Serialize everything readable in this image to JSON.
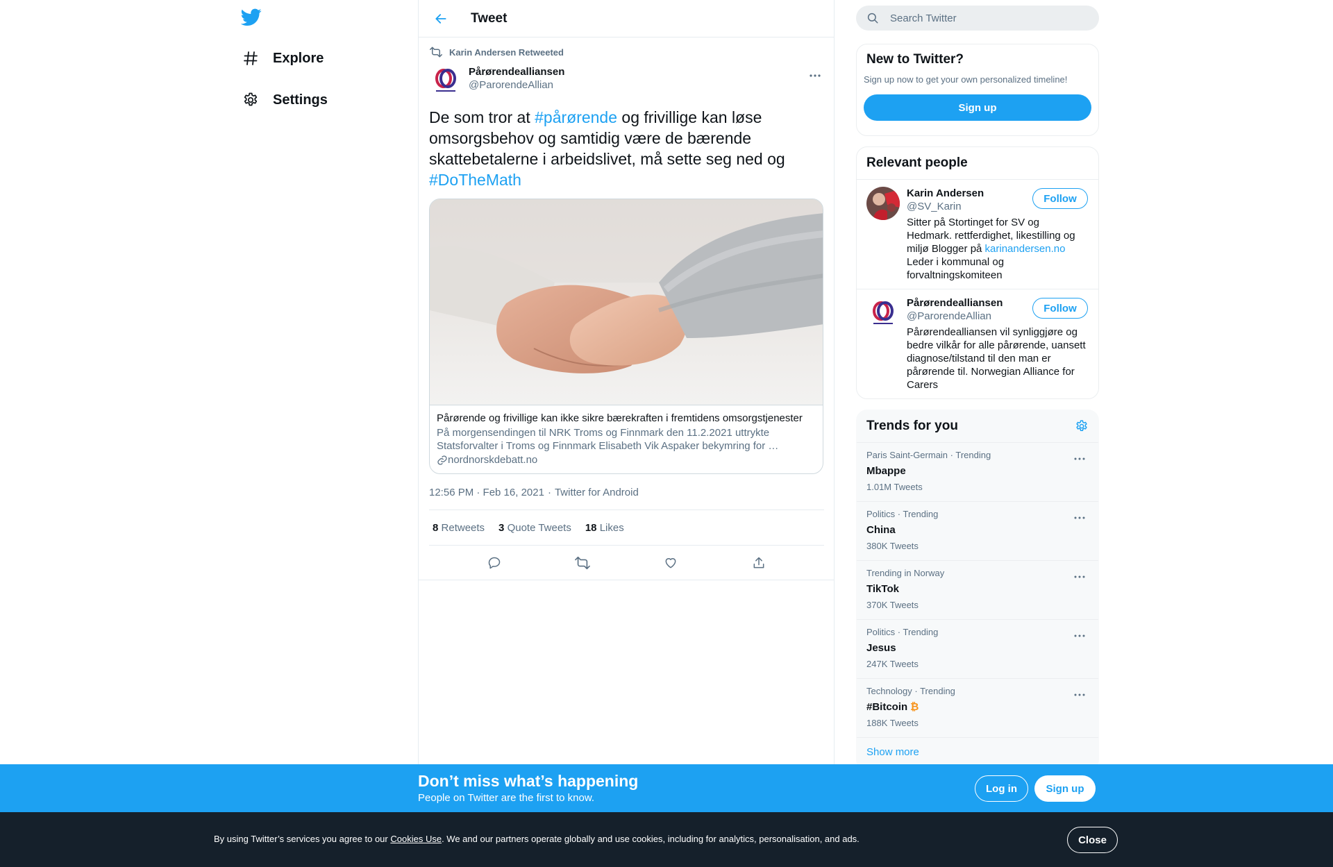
{
  "nav": {
    "logo_icon": "twitter-bird-icon",
    "items": [
      {
        "label": "Explore",
        "icon": "hashtag-icon"
      },
      {
        "label": "Settings",
        "icon": "gear-icon"
      }
    ]
  },
  "header": {
    "title": "Tweet",
    "back_icon": "back-arrow-icon"
  },
  "tweet": {
    "retweeted_by": "Karin Andersen Retweeted",
    "author": {
      "name": "Pårørendealliansen",
      "handle": "@ParorendeAllian"
    },
    "text_parts": {
      "t1": "De som tror at ",
      "h1": "#pårørende",
      "t2": " og frivillige kan løse omsorgsbehov og samtidig være de bærende skattebetalerne i arbeidslivet,  må sette seg ned og ",
      "h2": "#DoTheMath"
    },
    "card": {
      "title": "Pårørende og frivillige kan ikke sikre bærekraften i fremtidens omsorgstjenester",
      "description": "På morgensendingen til NRK Troms og Finnmark den 11.2.2021 uttrykte Statsforvalter i Troms og Finnmark Elisabeth Vik Aspaker bekymring for …",
      "domain": "nordnorskdebatt.no"
    },
    "time": "12:56 PM · Feb 16, 2021",
    "source": "Twitter for Android",
    "stats": {
      "retweets_count": "8",
      "retweets_label": "Retweets",
      "quotes_count": "3",
      "quotes_label": "Quote Tweets",
      "likes_count": "18",
      "likes_label": "Likes"
    }
  },
  "search": {
    "placeholder": "Search Twitter"
  },
  "new_to_twitter": {
    "title": "New to Twitter?",
    "subtitle": "Sign up now to get your own personalized timeline!",
    "button": "Sign up"
  },
  "relevant_people": {
    "title": "Relevant people",
    "people": [
      {
        "name": "Karin Andersen",
        "handle": "@SV_Karin",
        "bio_before": "Sitter på Stortinget for SV og Hedmark. rettferdighet, likestilling og miljø Blogger på ",
        "bio_link": "karinandersen.no",
        "bio_after": " Leder i kommunal og forvaltningskomiteen",
        "follow": "Follow"
      },
      {
        "name": "Pårørendealliansen",
        "handle": "@ParorendeAllian",
        "bio": "Pårørendealliansen vil synliggjøre og bedre vilkår for alle pårørende, uansett diagnose/tilstand til den man er pårørende til. Norwegian Alliance for Carers",
        "follow": "Follow"
      }
    ]
  },
  "trends": {
    "title": "Trends for you",
    "items": [
      {
        "context": "Paris Saint-Germain · Trending",
        "name": "Mbappe",
        "count": "1.01M Tweets"
      },
      {
        "context": "Politics · Trending",
        "name": "China",
        "count": "380K Tweets"
      },
      {
        "context": "Trending in Norway",
        "name": "TikTok",
        "count": "370K Tweets"
      },
      {
        "context": "Politics · Trending",
        "name": "Jesus",
        "count": "247K Tweets"
      },
      {
        "context": "Technology · Trending",
        "name": "#Bitcoin",
        "count": "188K Tweets",
        "emoji": "₿"
      }
    ],
    "show_more": "Show more"
  },
  "signup_bar": {
    "title": "Don’t miss what’s happening",
    "subtitle": "People on Twitter are the first to know.",
    "login": "Log in",
    "signup": "Sign up"
  },
  "cookie_bar": {
    "text_before": "By using Twitter’s services you agree to our ",
    "link": "Cookies Use",
    "text_after": ". We and our partners operate globally and use cookies, including for analytics, personalisation, and ads.",
    "close": "Close"
  },
  "colors": {
    "accent": "#1da1f2",
    "text": "#0f1419",
    "secondary": "#5b7083",
    "cookie_bg": "#15202b"
  }
}
